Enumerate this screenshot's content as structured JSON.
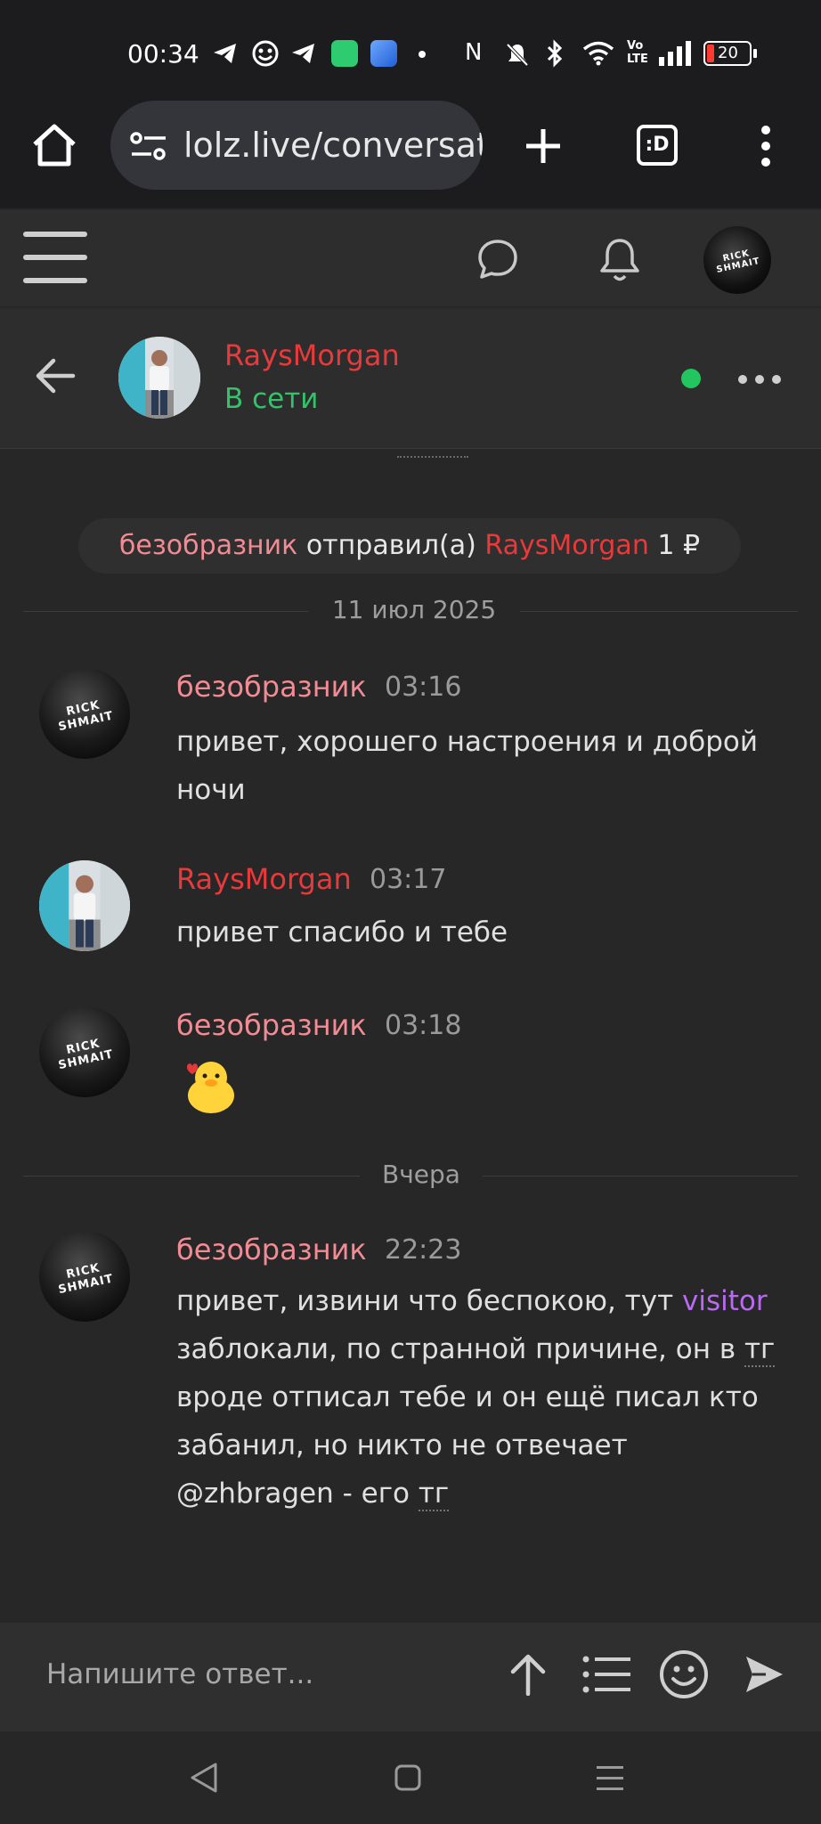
{
  "status_bar": {
    "time": "00:34",
    "battery": "20",
    "icons": [
      "telegram-icon",
      "emoji-icon",
      "telegram-icon",
      "green-app-icon",
      "blue-app-icon",
      "dot-icon",
      "nfc-icon",
      "mute-icon",
      "bluetooth-icon",
      "wifi-icon",
      "volte-icon",
      "signal-icon",
      "battery-icon"
    ]
  },
  "browser": {
    "url": "lolz.live/conversati",
    "tab_label": ":D"
  },
  "conversation": {
    "name": "RaysMorgan",
    "status": "В сети"
  },
  "transfer": {
    "sender": "безобразник",
    "verb": "отправил(а)",
    "recipient": "RaysMorgan",
    "amount": "1 ₽"
  },
  "dates": {
    "first": "11 июл 2025",
    "second": "Вчера"
  },
  "messages": [
    {
      "author": "безобразник",
      "time": "03:16",
      "text": "привет, хорошего настроения и доброй ночи"
    },
    {
      "author": "RaysMorgan",
      "time": "03:17",
      "text": "привет спасибо и тебе"
    },
    {
      "author": "безобразник",
      "time": "03:18",
      "sticker": "duck-sticker"
    },
    {
      "author": "безобразник",
      "time": "22:23",
      "text_a": "привет, извини что беспокою, тут",
      "mention": "visitor",
      "text_b": "заблокали, по странной причине, он в",
      "text_tg1": "тг",
      "text_c": "вроде отписал тебе и он ещё писал кто забанил, но никто не отвечает @zhbragen - его",
      "text_tg2": "тг"
    }
  ],
  "avatar_logo": "RICK SHMAIT",
  "composer": {
    "placeholder": "Напишите ответ..."
  },
  "colors": {
    "background": "#272727",
    "header": "#2d2d2d",
    "author_pink": "#f28b93",
    "author_red": "#e8393b",
    "online_green": "#22c55e",
    "mention_purple": "#b86bf0"
  }
}
